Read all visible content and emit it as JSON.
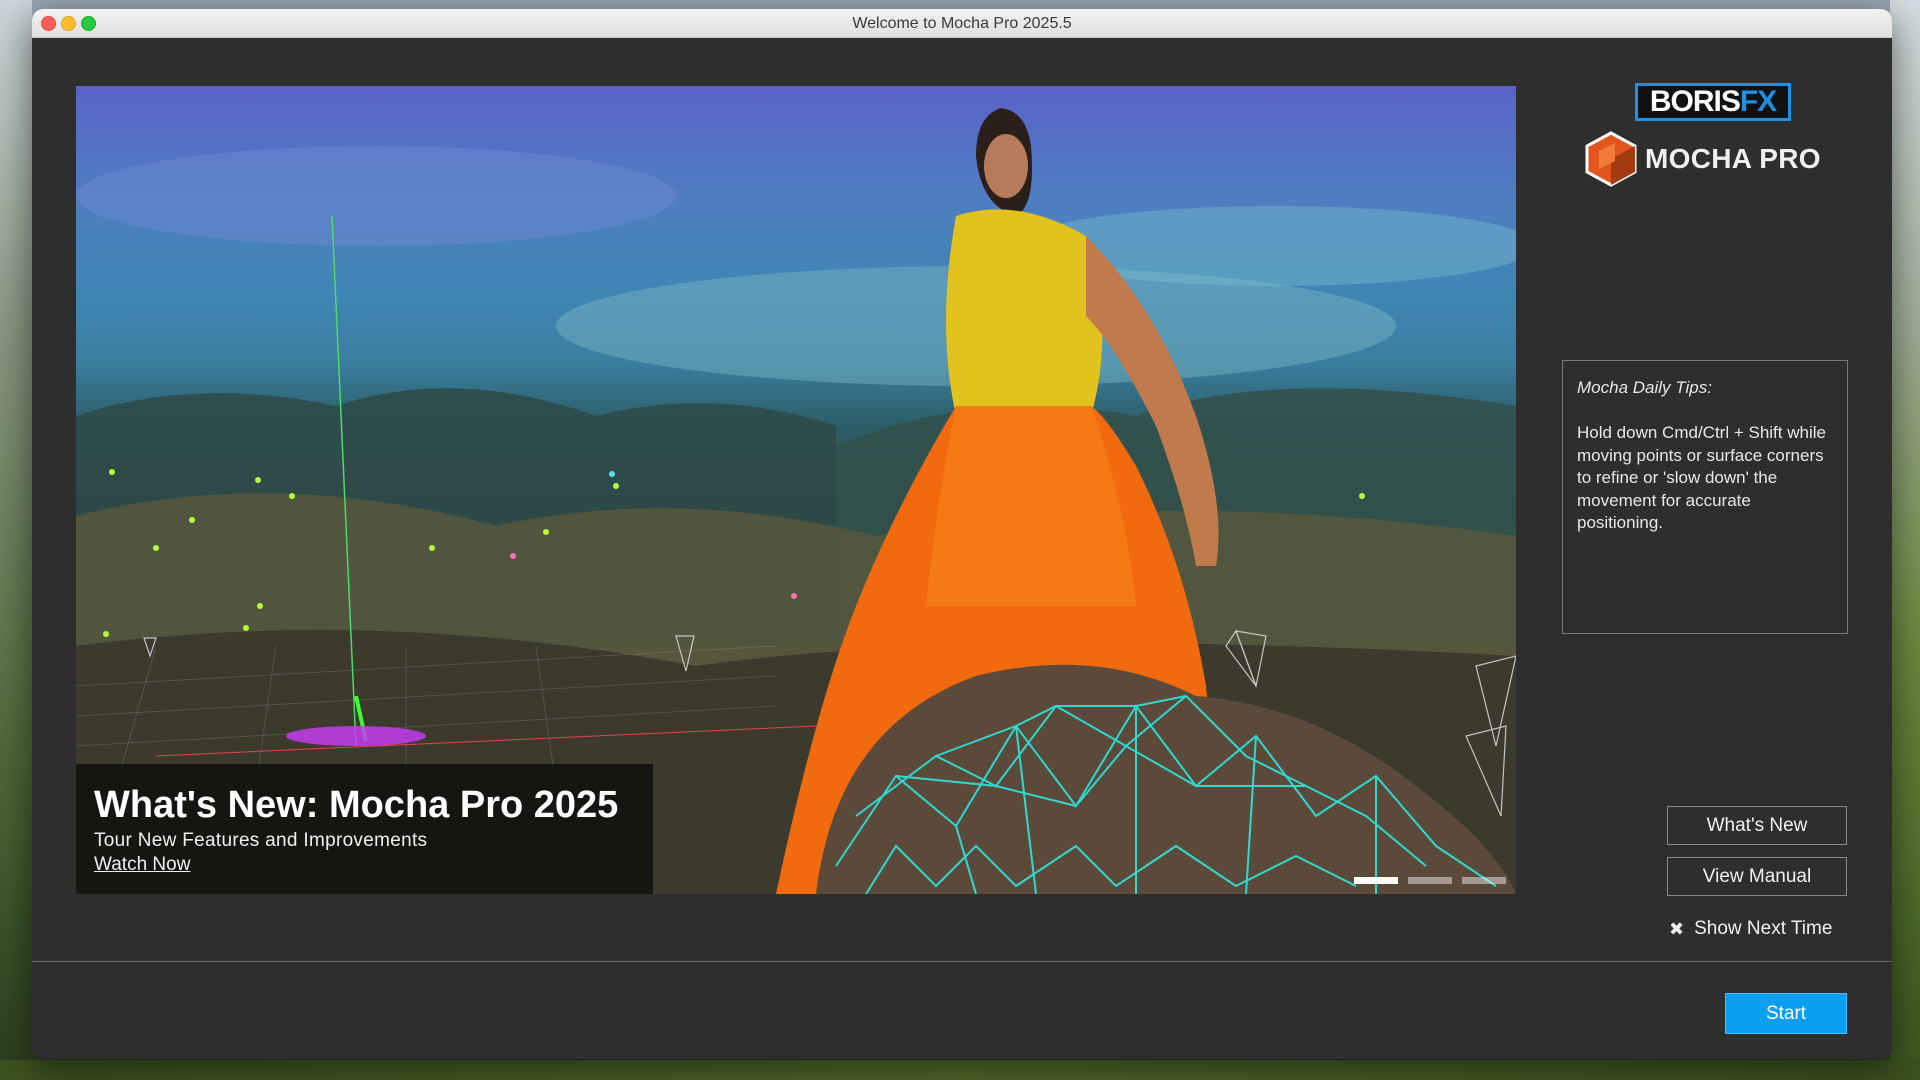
{
  "window": {
    "title": "Welcome to Mocha Pro 2025.5"
  },
  "hero": {
    "title": "What's New: Mocha Pro 2025",
    "subtitle": "Tour New Features and Improvements",
    "link": "Watch Now",
    "slides": 3,
    "active_slide": 1
  },
  "brand": {
    "boris_prefix": "BORIS",
    "boris_suffix": "FX",
    "product": "MOCHA PRO",
    "accent": "#1e8fe6",
    "logo_color": "#e2561e"
  },
  "tips": {
    "heading": "Mocha Daily Tips:",
    "body": "Hold down Cmd/Ctrl + Shift while moving points or surface corners to refine or 'slow down' the movement for accurate positioning."
  },
  "buttons": {
    "whats_new": "What's New",
    "view_manual": "View Manual",
    "show_next_time": "Show Next Time",
    "show_next_icon": "close-x-icon",
    "start": "Start"
  },
  "colors": {
    "window_bg": "#2e2e2e",
    "start_button": "#0a9ff0",
    "mesh": "#2fe0d8"
  }
}
